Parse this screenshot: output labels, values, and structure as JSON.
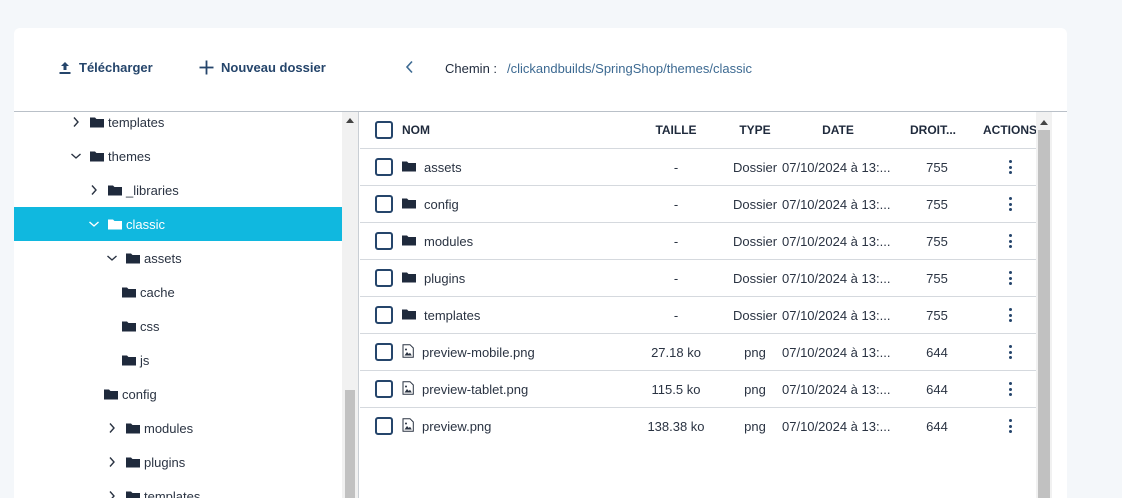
{
  "toolbar": {
    "upload_label": "Télécharger",
    "new_folder_label": "Nouveau dossier",
    "path_label": "Chemin :",
    "path_value": "/clickandbuilds/SpringShop/themes/classic"
  },
  "tree": {
    "items": [
      {
        "label": "templates",
        "expanded": false,
        "has_children": true
      },
      {
        "label": "themes",
        "expanded": true,
        "has_children": true
      },
      {
        "label": "_libraries",
        "expanded": false,
        "has_children": true
      },
      {
        "label": "classic",
        "expanded": true,
        "has_children": true,
        "selected": true
      },
      {
        "label": "assets",
        "expanded": true,
        "has_children": true
      },
      {
        "label": "cache",
        "has_children": false
      },
      {
        "label": "css",
        "has_children": false
      },
      {
        "label": "js",
        "has_children": false
      },
      {
        "label": "config",
        "has_children": false
      },
      {
        "label": "modules",
        "expanded": false,
        "has_children": true
      },
      {
        "label": "plugins",
        "expanded": false,
        "has_children": true
      },
      {
        "label": "templates",
        "expanded": false,
        "has_children": true
      }
    ]
  },
  "table": {
    "headers": {
      "name": "NOM",
      "size": "TAILLE",
      "type": "TYPE",
      "date": "DATE",
      "perm": "DROIT...",
      "actions": "ACTIONS"
    },
    "rows": [
      {
        "name": "assets",
        "kind": "folder",
        "size": "-",
        "type": "Dossier",
        "date": "07/10/2024 à 13:...",
        "perm": "755"
      },
      {
        "name": "config",
        "kind": "folder",
        "size": "-",
        "type": "Dossier",
        "date": "07/10/2024 à 13:...",
        "perm": "755"
      },
      {
        "name": "modules",
        "kind": "folder",
        "size": "-",
        "type": "Dossier",
        "date": "07/10/2024 à 13:...",
        "perm": "755"
      },
      {
        "name": "plugins",
        "kind": "folder",
        "size": "-",
        "type": "Dossier",
        "date": "07/10/2024 à 13:...",
        "perm": "755"
      },
      {
        "name": "templates",
        "kind": "folder",
        "size": "-",
        "type": "Dossier",
        "date": "07/10/2024 à 13:...",
        "perm": "755"
      },
      {
        "name": "preview-mobile.png",
        "kind": "image",
        "size": "27.18 ko",
        "type": "png",
        "date": "07/10/2024 à 13:...",
        "perm": "644"
      },
      {
        "name": "preview-tablet.png",
        "kind": "image",
        "size": "115.5 ko",
        "type": "png",
        "date": "07/10/2024 à 13:...",
        "perm": "644"
      },
      {
        "name": "preview.png",
        "kind": "image",
        "size": "138.38 ko",
        "type": "png",
        "date": "07/10/2024 à 13:...",
        "perm": "644"
      }
    ]
  },
  "icons": {
    "upload": "upload-icon",
    "new_folder": "plus-icon",
    "back": "chevron-left-icon",
    "folder": "folder-icon",
    "image_file": "image-file-icon",
    "more": "kebab-menu-icon"
  },
  "colors": {
    "accent": "#10b8df",
    "primary_text": "#25456b",
    "path_link": "#3d6a92"
  }
}
